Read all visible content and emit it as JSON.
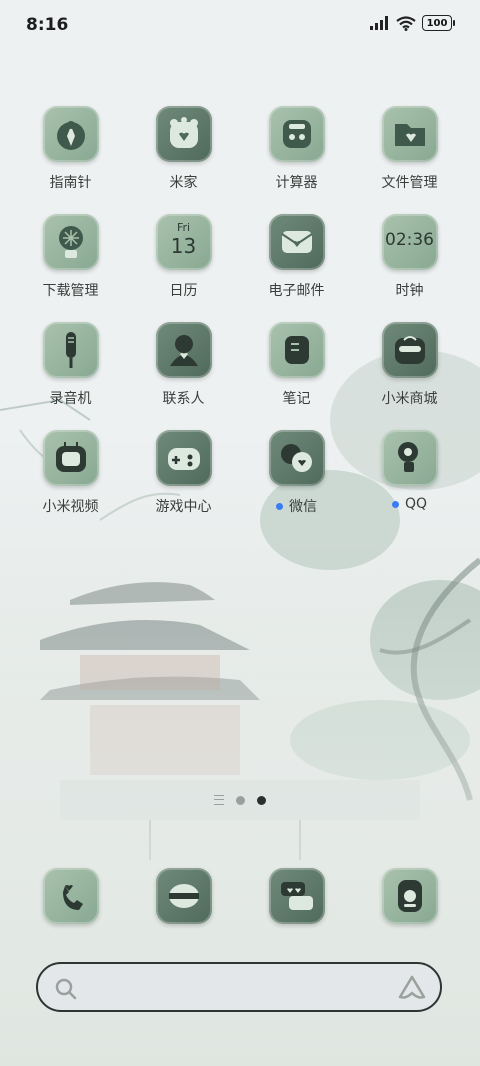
{
  "status_bar": {
    "time": "8:16",
    "battery": "100"
  },
  "apps": [
    {
      "label": "指南针"
    },
    {
      "label": "米家"
    },
    {
      "label": "计算器"
    },
    {
      "label": "文件管理"
    },
    {
      "label": "下载管理"
    },
    {
      "label": "日历",
      "day": "Fri",
      "date": "13"
    },
    {
      "label": "电子邮件"
    },
    {
      "label": "时钟",
      "clock": "02:36"
    },
    {
      "label": "录音机"
    },
    {
      "label": "联系人"
    },
    {
      "label": "笔记"
    },
    {
      "label": "小米商城"
    },
    {
      "label": "小米视频"
    },
    {
      "label": "游戏中心"
    },
    {
      "label": "微信",
      "badge": true
    },
    {
      "label": "QQ",
      "badge": true
    }
  ],
  "dock": [
    {
      "icon": "phone-icon"
    },
    {
      "icon": "messages-icon"
    },
    {
      "icon": "chat-icon"
    },
    {
      "icon": "camera-icon"
    }
  ],
  "pager": {
    "pages": 2,
    "current": 2
  },
  "colors": {
    "icon_light": "#a9c2ad",
    "icon_dark": "#4f6a5b",
    "badge": "#3a7cf5"
  }
}
